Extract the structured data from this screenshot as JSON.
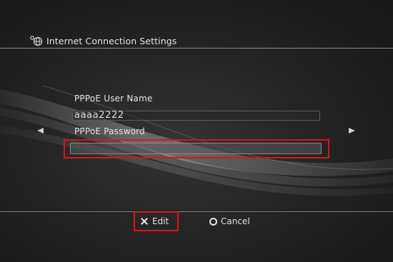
{
  "header": {
    "icon": "network-globe-icon",
    "title": "Internet Connection Settings"
  },
  "form": {
    "user_name_label": "PPPoE User Name",
    "user_name_value": "aaaa2222",
    "password_label": "PPPoE Password",
    "password_value": ""
  },
  "nav": {
    "left_arrow_icon": "arrow-left-icon",
    "right_arrow_icon": "arrow-right-icon"
  },
  "footer": {
    "edit_icon": "cross-button-icon",
    "edit_label": "Edit",
    "cancel_icon": "circle-button-icon",
    "cancel_label": "Cancel"
  },
  "colors": {
    "highlight": "#e0121a",
    "background": "#1c1c1c",
    "text": "#e2e2e2"
  }
}
